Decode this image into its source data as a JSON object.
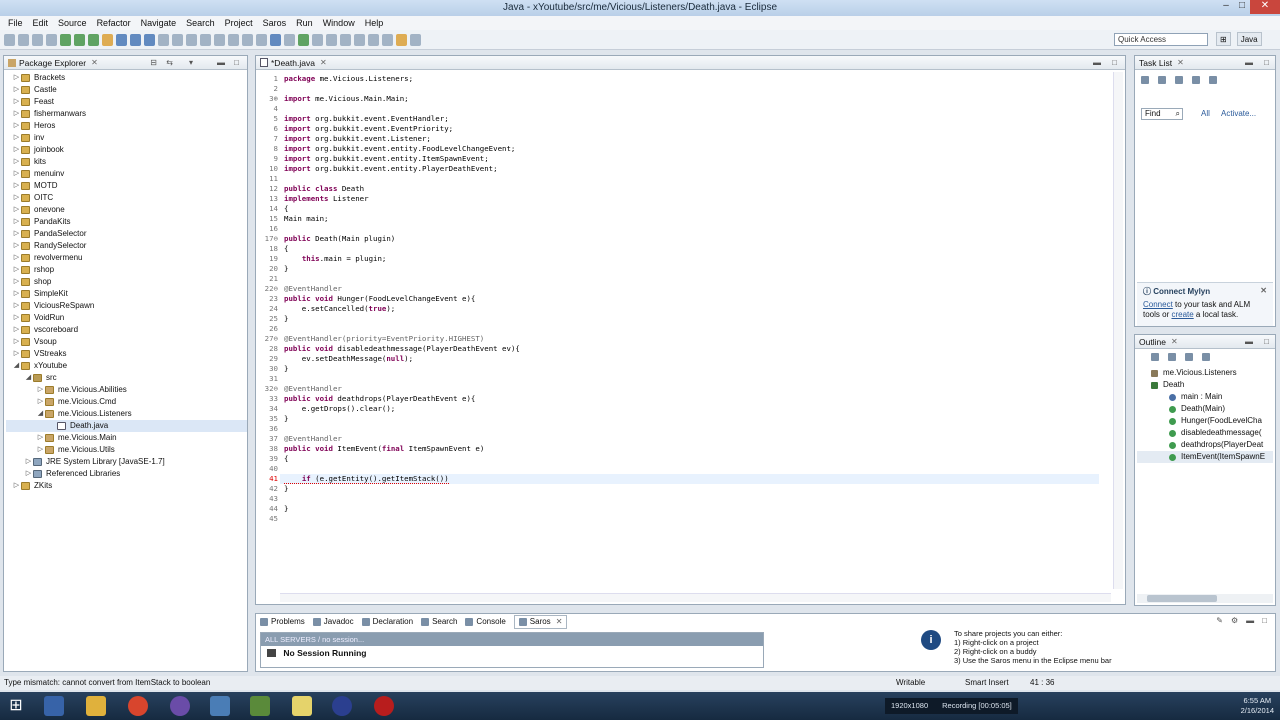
{
  "window": {
    "title": "Java - xYoutube/src/me/Vicious/Listeners/Death.java - Eclipse",
    "min": "–",
    "max": "□",
    "close": "✕"
  },
  "menu": [
    "File",
    "Edit",
    "Source",
    "Refactor",
    "Navigate",
    "Search",
    "Project",
    "Saros",
    "Run",
    "Window",
    "Help"
  ],
  "quick_access": "Quick Access",
  "perspective": {
    "java": "Java"
  },
  "package_explorer": {
    "tab": "Package Explorer",
    "items": [
      {
        "label": "Brackets",
        "depth": 0,
        "type": "proj"
      },
      {
        "label": "Castle",
        "depth": 0,
        "type": "proj"
      },
      {
        "label": "Feast",
        "depth": 0,
        "type": "proj"
      },
      {
        "label": "fishermanwars",
        "depth": 0,
        "type": "proj"
      },
      {
        "label": "Heros",
        "depth": 0,
        "type": "proj"
      },
      {
        "label": "inv",
        "depth": 0,
        "type": "proj"
      },
      {
        "label": "joinbook",
        "depth": 0,
        "type": "proj"
      },
      {
        "label": "kits",
        "depth": 0,
        "type": "proj"
      },
      {
        "label": "menuinv",
        "depth": 0,
        "type": "proj"
      },
      {
        "label": "MOTD",
        "depth": 0,
        "type": "proj"
      },
      {
        "label": "OITC",
        "depth": 0,
        "type": "proj"
      },
      {
        "label": "onevone",
        "depth": 0,
        "type": "proj"
      },
      {
        "label": "PandaKits",
        "depth": 0,
        "type": "proj"
      },
      {
        "label": "PandaSelector",
        "depth": 0,
        "type": "proj"
      },
      {
        "label": "RandySelector",
        "depth": 0,
        "type": "proj"
      },
      {
        "label": "revolvermenu",
        "depth": 0,
        "type": "proj"
      },
      {
        "label": "rshop",
        "depth": 0,
        "type": "proj"
      },
      {
        "label": "shop",
        "depth": 0,
        "type": "proj"
      },
      {
        "label": "SimpleKit",
        "depth": 0,
        "type": "proj"
      },
      {
        "label": "ViciousReSpawn",
        "depth": 0,
        "type": "proj"
      },
      {
        "label": "VoidRun",
        "depth": 0,
        "type": "proj"
      },
      {
        "label": "vscoreboard",
        "depth": 0,
        "type": "proj"
      },
      {
        "label": "Vsoup",
        "depth": 0,
        "type": "proj"
      },
      {
        "label": "VStreaks",
        "depth": 0,
        "type": "proj"
      },
      {
        "label": "xYoutube",
        "depth": 0,
        "type": "proj",
        "open": true
      },
      {
        "label": "src",
        "depth": 1,
        "type": "src",
        "open": true
      },
      {
        "label": "me.Vicious.Abilities",
        "depth": 2,
        "type": "pkg"
      },
      {
        "label": "me.Vicious.Cmd",
        "depth": 2,
        "type": "pkg"
      },
      {
        "label": "me.Vicious.Listeners",
        "depth": 2,
        "type": "pkg",
        "open": true
      },
      {
        "label": "Death.java",
        "depth": 3,
        "type": "java",
        "selected": true
      },
      {
        "label": "me.Vicious.Main",
        "depth": 2,
        "type": "pkg"
      },
      {
        "label": "me.Vicious.Utils",
        "depth": 2,
        "type": "pkg"
      },
      {
        "label": "JRE System Library [JavaSE-1.7]",
        "depth": 1,
        "type": "lib"
      },
      {
        "label": "Referenced Libraries",
        "depth": 1,
        "type": "lib"
      },
      {
        "label": "ZKits",
        "depth": 0,
        "type": "proj"
      }
    ]
  },
  "editor": {
    "tab": "*Death.java",
    "lines": [
      {
        "n": "1",
        "t": "package me.Vicious.Listeners;"
      },
      {
        "n": "2",
        "t": ""
      },
      {
        "n": "3⊕",
        "t": "import me.Vicious.Main.Main;"
      },
      {
        "n": "4",
        "t": ""
      },
      {
        "n": "5",
        "t": "import org.bukkit.event.EventHandler;"
      },
      {
        "n": "6",
        "t": "import org.bukkit.event.EventPriority;"
      },
      {
        "n": "7",
        "t": "import org.bukkit.event.Listener;"
      },
      {
        "n": "8",
        "t": "import org.bukkit.event.entity.FoodLevelChangeEvent;"
      },
      {
        "n": "9",
        "t": "import org.bukkit.event.entity.ItemSpawnEvent;"
      },
      {
        "n": "10",
        "t": "import org.bukkit.event.entity.PlayerDeathEvent;"
      },
      {
        "n": "11",
        "t": ""
      },
      {
        "n": "12",
        "t": "public class Death"
      },
      {
        "n": "13",
        "t": "implements Listener"
      },
      {
        "n": "14",
        "t": "{"
      },
      {
        "n": "15",
        "t": "Main main;"
      },
      {
        "n": "16",
        "t": ""
      },
      {
        "n": "17⊖",
        "t": "public Death(Main plugin)"
      },
      {
        "n": "18",
        "t": "{"
      },
      {
        "n": "19",
        "t": "    this.main = plugin;"
      },
      {
        "n": "20",
        "t": "}"
      },
      {
        "n": "21",
        "t": ""
      },
      {
        "n": "22⊖",
        "t": "@EventHandler"
      },
      {
        "n": "23",
        "t": "public void Hunger(FoodLevelChangeEvent e){"
      },
      {
        "n": "24",
        "t": "    e.setCancelled(true);"
      },
      {
        "n": "25",
        "t": "}"
      },
      {
        "n": "26",
        "t": ""
      },
      {
        "n": "27⊖",
        "t": "@EventHandler(priority=EventPriority.HIGHEST)"
      },
      {
        "n": "28",
        "t": "public void disabledeathmessage(PlayerDeathEvent ev){"
      },
      {
        "n": "29",
        "t": "    ev.setDeathMessage(null);"
      },
      {
        "n": "30",
        "t": "}"
      },
      {
        "n": "31",
        "t": ""
      },
      {
        "n": "32⊖",
        "t": "@EventHandler"
      },
      {
        "n": "33",
        "t": "public void deathdrops(PlayerDeathEvent e){"
      },
      {
        "n": "34",
        "t": "    e.getDrops().clear();"
      },
      {
        "n": "35",
        "t": "}"
      },
      {
        "n": "36",
        "t": ""
      },
      {
        "n": "37",
        "t": "@EventHandler"
      },
      {
        "n": "38",
        "t": "public void ItemEvent(final ItemSpawnEvent e)"
      },
      {
        "n": "39",
        "t": "{"
      },
      {
        "n": "40",
        "t": ""
      },
      {
        "n": "41",
        "t": "    if (e.getEntity().getItemStack())"
      },
      {
        "n": "42",
        "t": "}"
      },
      {
        "n": "43",
        "t": ""
      },
      {
        "n": "44",
        "t": "}"
      },
      {
        "n": "45",
        "t": ""
      }
    ]
  },
  "task_list": {
    "tab": "Task List",
    "find": "Find",
    "all": "All",
    "activate": "Activate..."
  },
  "mylyn": {
    "title": "Connect Mylyn",
    "connect": "Connect",
    "mid": " to your task and ALM tools or ",
    "create": "create",
    "end": " a local task."
  },
  "outline": {
    "tab": "Outline",
    "items": [
      {
        "label": "me.Vicious.Listeners",
        "depth": 0
      },
      {
        "label": "Death",
        "depth": 0
      },
      {
        "label": "main : Main",
        "depth": 1
      },
      {
        "label": "Death(Main)",
        "depth": 1
      },
      {
        "label": "Hunger(FoodLevelCha",
        "depth": 1
      },
      {
        "label": "disabledeathmessage(",
        "depth": 1
      },
      {
        "label": "deathdrops(PlayerDeat",
        "depth": 1
      },
      {
        "label": "ItemEvent(ItemSpawnE",
        "depth": 1
      }
    ]
  },
  "bottom": {
    "tabs": [
      "Problems",
      "Javadoc",
      "Declaration",
      "Search",
      "Console",
      "Saros"
    ],
    "session_header": "ALL SERVERS / no session...",
    "session": "No Session Running",
    "info_lines": [
      "To share projects you can either:",
      "1) Right-click on a project",
      "2) Right-click on a buddy",
      "3) Use the Saros menu in the Eclipse menu bar"
    ]
  },
  "status": {
    "message": "Type mismatch: cannot convert from ItemStack to boolean",
    "writable": "Writable",
    "insert": "Smart Insert",
    "position": "41 : 36"
  },
  "taskbar": {
    "resolution": "1920x1080",
    "recording": "Recording [00:05:05]",
    "time": "6:55 AM",
    "date": "2/16/2014"
  },
  "colors": {
    "accent": "#3d6fb3",
    "error": "#d00000",
    "keyword": "#7f0055"
  }
}
